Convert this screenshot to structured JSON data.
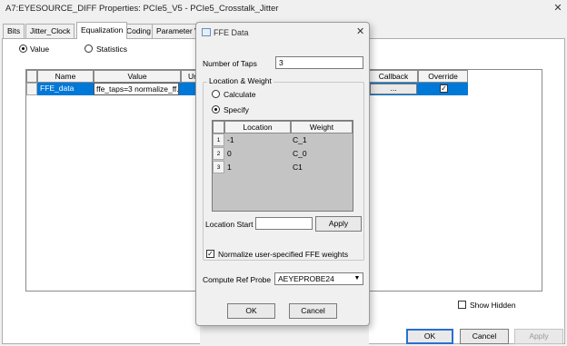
{
  "window": {
    "title": "A7:EYESOURCE_DIFF Properties: PCIe5_V5 - PCIe5_Crosstalk_Jitter",
    "close_glyph": "✕"
  },
  "tabs": [
    {
      "label": "Bits"
    },
    {
      "label": "Jitter_Clock"
    },
    {
      "label": "Equalization"
    },
    {
      "label": "Coding"
    },
    {
      "label": "Parameter Va"
    }
  ],
  "view_mode": {
    "value_label": "Value",
    "statistics_label": "Statistics",
    "selected": "Value"
  },
  "param_table": {
    "headers": {
      "name": "Name",
      "value": "Value",
      "unit_partial": "Un",
      "callback": "Callback",
      "override": "Override"
    },
    "row": {
      "name": "FFE_data",
      "value": "ffe_taps=3 normalize_ff...",
      "callback_button": "...",
      "override_checked": true
    }
  },
  "show_hidden": {
    "label": "Show Hidden",
    "checked": false
  },
  "footer": {
    "ok": "OK",
    "cancel": "Cancel",
    "apply": "Apply"
  },
  "dialog": {
    "title": "FFE Data",
    "close_glyph": "✕",
    "number_of_taps_label": "Number of Taps",
    "number_of_taps_value": "3",
    "group_label": "Location & Weight",
    "calculate_label": "Calculate",
    "specify_label": "Specify",
    "selected_mode": "Specify",
    "table": {
      "headers": {
        "location": "Location",
        "weight": "Weight"
      },
      "rows": [
        {
          "num": "1",
          "location": "-1",
          "weight": "C_1"
        },
        {
          "num": "2",
          "location": "0",
          "weight": "C_0"
        },
        {
          "num": "3",
          "location": "1",
          "weight": "C1"
        }
      ]
    },
    "location_start_label": "Location Start",
    "location_start_value": "",
    "apply_label": "Apply",
    "normalize_label": "Normalize user-specified FFE weights",
    "normalize_checked": true,
    "compute_ref_probe_label": "Compute Ref Probe",
    "compute_ref_probe_value": "AEYEPROBE24",
    "ok_label": "OK",
    "cancel_label": "Cancel"
  },
  "colors": {
    "selection_blue": "#0078d7",
    "grid_gray": "#c4c4c4"
  }
}
